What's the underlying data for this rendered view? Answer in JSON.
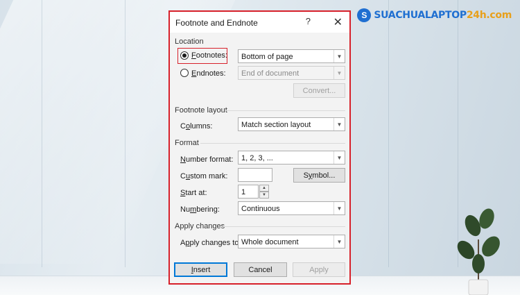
{
  "logo": {
    "mark": "S",
    "text_main": "SUACHUALAPTOP",
    "text_accent": "24h.com"
  },
  "dialog": {
    "title": "Footnote and Endnote",
    "help_icon": "?",
    "close_icon": "✕",
    "location": {
      "heading": "Location",
      "footnotes": {
        "label_mnemonic": "F",
        "label_rest": "ootnotes:",
        "selected": true,
        "value": "Bottom of page"
      },
      "endnotes": {
        "label_mnemonic": "E",
        "label_rest": "ndnotes:",
        "selected": false,
        "value": "End of document"
      },
      "convert_label": "Convert..."
    },
    "footnote_layout": {
      "heading": "Footnote layout",
      "columns_label_mnemonic": "o",
      "columns_label_pre": "C",
      "columns_label_rest": "lumns:",
      "columns_value": "Match section layout"
    },
    "format": {
      "heading": "Format",
      "number_format_mnemonic": "N",
      "number_format_rest": "umber format:",
      "number_format_value": "1, 2, 3, ...",
      "custom_mark_pre": "C",
      "custom_mark_mnemonic": "u",
      "custom_mark_rest": "stom mark:",
      "custom_mark_value": "",
      "symbol_label_pre": "S",
      "symbol_label_mnemonic": "y",
      "symbol_label_rest": "mbol...",
      "start_at_pre": "",
      "start_at_mnemonic": "S",
      "start_at_rest": "tart at:",
      "start_at_value": "1",
      "numbering_pre": "Nu",
      "numbering_mnemonic": "m",
      "numbering_rest": "bering:",
      "numbering_value": "Continuous"
    },
    "apply_changes": {
      "heading": "Apply changes",
      "apply_to_pre": "A",
      "apply_to_mnemonic": "p",
      "apply_to_rest": "ply changes to:",
      "apply_to_value": "Whole document"
    },
    "buttons": {
      "insert_mnemonic": "I",
      "insert_rest": "nsert",
      "cancel": "Cancel",
      "apply": "Apply"
    }
  },
  "colors": {
    "highlight": "#d7202a",
    "accent": "#0078d7",
    "logo_blue": "#1f6fd1",
    "logo_orange": "#e8a01b"
  }
}
